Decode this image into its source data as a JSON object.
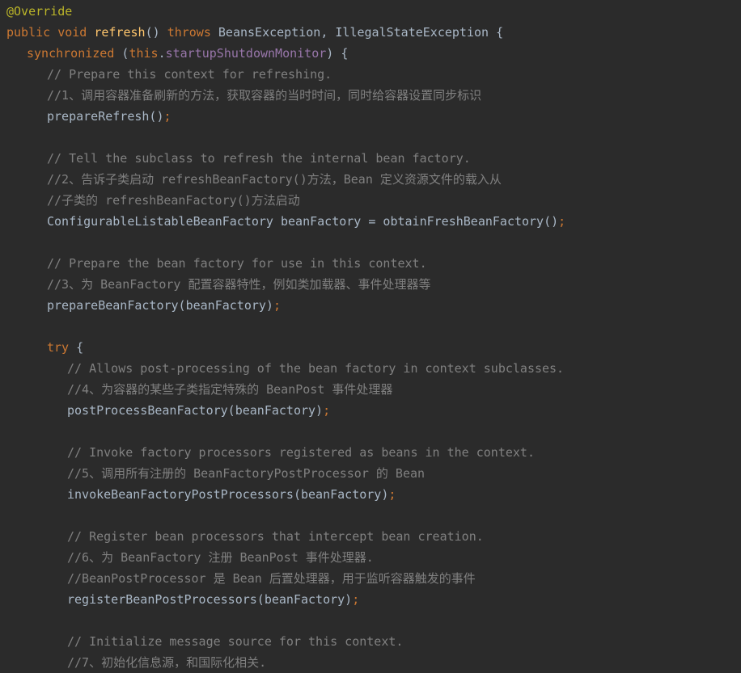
{
  "colors": {
    "background": "#2b2b2b",
    "keyword": "#cc7832",
    "annotation": "#bbb529",
    "method": "#ffc66d",
    "field": "#9876aa",
    "comment": "#808080",
    "plain": "#a9b7c6"
  },
  "code": {
    "l01": {
      "annotation": "@Override"
    },
    "l02": {
      "kw1": "public",
      "kw2": "void",
      "method": "refresh",
      "parens": "()",
      "kw3": "throws",
      "types": "BeansException, IllegalStateException {"
    },
    "l03": {
      "kw": "synchronized",
      "open": " (",
      "this": "this",
      "dot": ".",
      "field": "startupShutdownMonitor",
      "close": ") {"
    },
    "l04": {
      "comment": "// Prepare this context for refreshing."
    },
    "l05": {
      "comment": "//1、调用容器准备刷新的方法，获取容器的当时时间，同时给容器设置同步标识"
    },
    "l06": {
      "stmt": "prepareRefresh()",
      "semi": ";"
    },
    "l08": {
      "comment": "// Tell the subclass to refresh the internal bean factory."
    },
    "l09": {
      "comment": "//2、告诉子类启动 refreshBeanFactory()方法，Bean 定义资源文件的载入从"
    },
    "l10": {
      "comment": "//子类的 refreshBeanFactory()方法启动"
    },
    "l11": {
      "stmt": "ConfigurableListableBeanFactory beanFactory = obtainFreshBeanFactory()",
      "semi": ";"
    },
    "l13": {
      "comment": "// Prepare the bean factory for use in this context."
    },
    "l14": {
      "comment": "//3、为 BeanFactory 配置容器特性，例如类加载器、事件处理器等"
    },
    "l15": {
      "stmt": "prepareBeanFactory(beanFactory)",
      "semi": ";"
    },
    "l17": {
      "kw": "try",
      "brace": " {"
    },
    "l18": {
      "comment": "// Allows post-processing of the bean factory in context subclasses."
    },
    "l19": {
      "comment": "//4、为容器的某些子类指定特殊的 BeanPost 事件处理器"
    },
    "l20": {
      "stmt": "postProcessBeanFactory(beanFactory)",
      "semi": ";"
    },
    "l22": {
      "comment": "// Invoke factory processors registered as beans in the context."
    },
    "l23": {
      "comment": "//5、调用所有注册的 BeanFactoryPostProcessor 的 Bean"
    },
    "l24": {
      "stmt": "invokeBeanFactoryPostProcessors(beanFactory)",
      "semi": ";"
    },
    "l26": {
      "comment": "// Register bean processors that intercept bean creation."
    },
    "l27": {
      "comment": "//6、为 BeanFactory 注册 BeanPost 事件处理器."
    },
    "l28": {
      "comment": "//BeanPostProcessor 是 Bean 后置处理器，用于监听容器触发的事件"
    },
    "l29": {
      "stmt": "registerBeanPostProcessors(beanFactory)",
      "semi": ";"
    },
    "l31": {
      "comment": "// Initialize message source for this context."
    },
    "l32": {
      "comment": "//7、初始化信息源，和国际化相关."
    }
  }
}
